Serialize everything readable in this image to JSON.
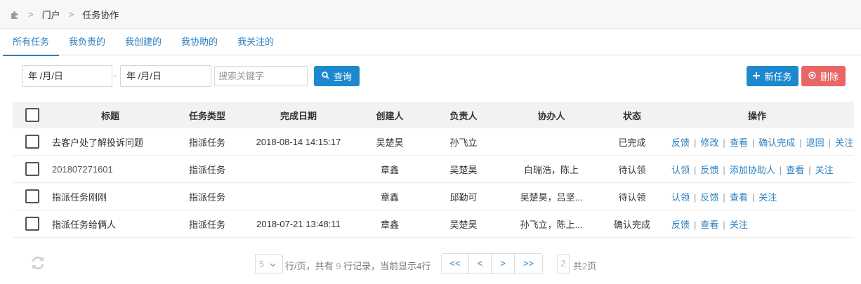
{
  "breadcrumb": {
    "icon": "puzzle-icon",
    "items": [
      "门户",
      "任务协作"
    ]
  },
  "tabs": [
    {
      "label": "所有任务",
      "active": true
    },
    {
      "label": "我负责的",
      "active": false
    },
    {
      "label": "我创建的",
      "active": false
    },
    {
      "label": "我协助的",
      "active": false
    },
    {
      "label": "我关注的",
      "active": false
    }
  ],
  "filters": {
    "start_date": "年 /月/日",
    "separator": "-",
    "end_date": "年 /月/日",
    "search_placeholder": "搜索关键字",
    "query_label": "查询"
  },
  "actions": {
    "new_label": "新任务",
    "delete_label": "删除"
  },
  "colors": {
    "primary": "#1e88cf",
    "danger": "#ea6666",
    "link": "#2a7fc1"
  },
  "table": {
    "headers": {
      "title": "标题",
      "type": "任务类型",
      "date": "完成日期",
      "creator": "创建人",
      "owner": "负责人",
      "assist": "协办人",
      "status": "状态",
      "ops": "操作"
    },
    "rows": [
      {
        "title": "去客户处了解投诉问题",
        "type": "指派任务",
        "date": "2018-08-14 14:15:17",
        "creator": "吴楚昊",
        "owner": "孙飞立",
        "assist": "",
        "status": "已完成",
        "ops": [
          "反馈",
          "修改",
          "查看",
          "确认完成",
          "退回",
          "关注"
        ]
      },
      {
        "title": "201807271601",
        "type": "指派任务",
        "date": "",
        "creator": "章鑫",
        "owner": "吴楚昊",
        "assist": "白瑞浩，陈上",
        "status": "待认领",
        "ops": [
          "认领",
          "反馈",
          "添加协助人",
          "查看",
          "关注"
        ]
      },
      {
        "title": "指派任务刚刚",
        "type": "指派任务",
        "date": "",
        "creator": "章鑫",
        "owner": "邱勤可",
        "assist": "吴楚昊，吕坚...",
        "status": "待认领",
        "ops": [
          "认领",
          "反馈",
          "查看",
          "关注"
        ]
      },
      {
        "title": "指派任务给俩人",
        "type": "指派任务",
        "date": "2018-07-21 13:48:11",
        "creator": "章鑫",
        "owner": "吴楚昊",
        "assist": "孙飞立，陈上...",
        "status": "确认完成",
        "ops": [
          "反馈",
          "查看",
          "关注"
        ]
      }
    ]
  },
  "pagination": {
    "page_size": "5",
    "text_a": "行/页，共有",
    "total_rows": "9",
    "text_b": "行记录，当前显示4行",
    "buttons": [
      "<<",
      "<",
      ">",
      ">>"
    ],
    "current_page": "2",
    "text_c": "共",
    "total_pages": "2",
    "text_d": "页"
  }
}
